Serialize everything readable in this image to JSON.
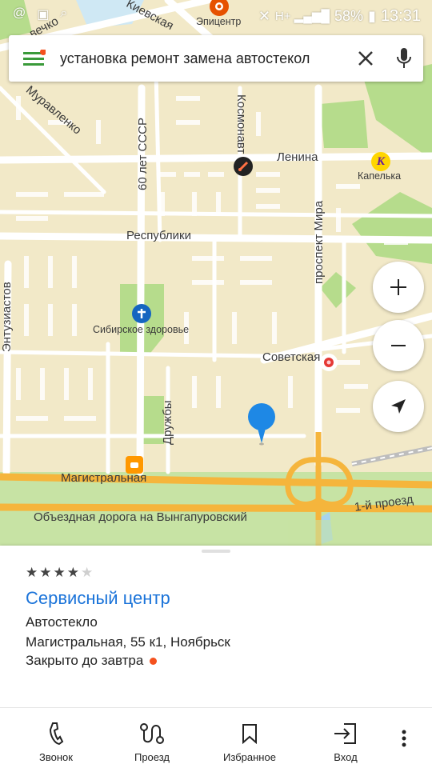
{
  "status_bar": {
    "battery": "58%",
    "time": "13:31"
  },
  "search": {
    "query": "установка ремонт замена автостекол"
  },
  "map": {
    "streets": {
      "kievskaya": "Киевская",
      "muravlenko": "Муравленко",
      "lenina": "Ленина",
      "respubliki": "Республики",
      "sixty_let": "60 лет СССР",
      "kosmonavtov": "Космонавт",
      "prospekt_mira": "проспект Мира",
      "entuziastov": "Энтузиастов",
      "sovetskaya": "Советская",
      "druzhby": "Дружбы",
      "magistralnaya": "Магистральная",
      "obezdnaya": "Объездная дорога на Вынгапуровский",
      "first_proezd": "1-й проезд",
      "partial_top": "вечко"
    },
    "pois": {
      "epicentr": "Эпицентр",
      "kapelka": "Капелька",
      "sibirskoe": "Сибирское здоровье"
    }
  },
  "card": {
    "rating": 4,
    "rating_max": 5,
    "name": "Сервисный центр",
    "category": "Автостекло",
    "address": "Магистральная, 55 к1, Ноябрьск",
    "hours": "Закрыто до завтра"
  },
  "nav": {
    "call": "Звонок",
    "route": "Проезд",
    "favorites": "Избранное",
    "login": "Вход"
  },
  "colors": {
    "accent": "#1a73d9",
    "menu_icon": "#3a9a3a",
    "road_major": "#f5b53c",
    "park": "#b6dc8c",
    "closed_dot": "#f4511e"
  }
}
